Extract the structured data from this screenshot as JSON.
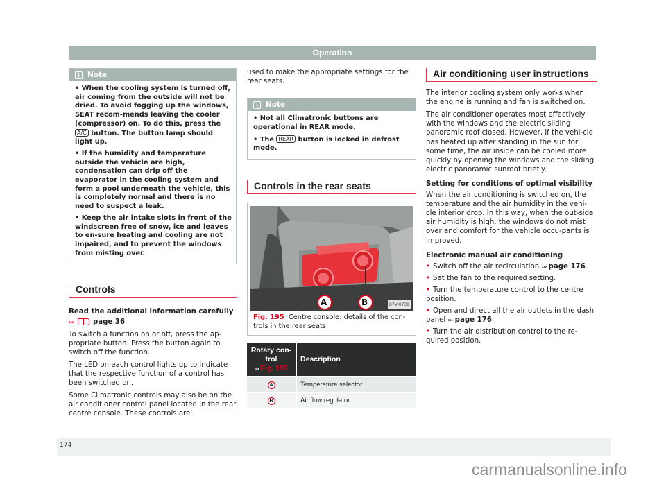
{
  "header": {
    "title": "Operation"
  },
  "col1": {
    "note": {
      "label": "Note",
      "items": [
        {
          "pre": "When the cooling system is turned off, air coming from the outside will not be dried. To avoid fogging up the windows, SEAT recom-mends leaving the cooler (compressor) on. To do this, press the ",
          "key": "A/C",
          "post": " button. The button lamp should light up."
        },
        {
          "text": "If the humidity and temperature outside the vehicle are high, condensation can drip off the evaporator in the cooling system and form a pool underneath the vehicle, this is completely normal and there is no need to suspect a leak."
        },
        {
          "text": "Keep the air intake slots in front of the windscreen free of snow, ice and leaves to en-sure heating and cooling are not impaired, and to prevent the windows from misting over."
        }
      ]
    },
    "controls": {
      "title": "Controls",
      "read_more": "Read the additional information carefully",
      "arrow": "›››",
      "page_ref": "page 36",
      "paragraphs": [
        "To switch a function on or off, press the ap-propriate button. Press the button again to switch off the function.",
        "The LED on each control lights up to indicate that the respective function of a control has been switched on.",
        "Some Climatronic controls may also be on the air conditioner control panel located in the rear centre console. These controls are"
      ]
    }
  },
  "col2": {
    "continuation": "used to make the appropriate settings for the rear seats.",
    "note": {
      "label": "Note",
      "item1": "Not all Climatronic buttons are operational in REAR mode.",
      "item2_pre": "The ",
      "item2_key": "REAR",
      "item2_post": " button is locked in defrost mode."
    },
    "section_title": "Controls in the rear seats",
    "figure": {
      "label_a": "A",
      "label_b": "B",
      "code": "B7V-0738",
      "caption_num": "Fig. 195",
      "caption_text": "Centre console: details of the con-trols in the rear seats"
    },
    "table": {
      "header_col1_line1": "Rotary con-trol",
      "header_col1_arrow": "›››",
      "header_col1_ref": "Fig. 195",
      "header_col2": "Description",
      "rows": [
        {
          "key": "A",
          "description": "Temperature selector"
        },
        {
          "key": "B",
          "description": "Air flow regulator"
        }
      ]
    }
  },
  "col3": {
    "section_title": "Air conditioning user instructions",
    "paragraphs": [
      "The interior cooling system only works when the engine is running and fan is switched on.",
      "The air conditioner operates most effectively with the windows and the electric sliding panoramic roof closed. However, if the vehi-cle has heated up after standing in the sun for some time, the air inside can be cooled more quickly by opening the windows and the sliding electric panoramic sunroof briefly."
    ],
    "visibility": {
      "heading": "Setting for conditions of optimal visibility",
      "text": "When the air conditioning is switched on, the temperature and the air humidity in the vehi-cle interior drop. In this way, when the out-side air humidity is high, the windows do not mist over and comfort for the vehicle occu-pants is improved."
    },
    "electronic": {
      "heading": "Electronic manual air conditioning",
      "arrow": "›››",
      "steps": [
        {
          "text": "Switch off the air recirculation ",
          "ref": "page 176",
          "end": "."
        },
        {
          "text": "Set the fan to the required setting."
        },
        {
          "text": "Turn the temperature control to the centre position."
        },
        {
          "text": "Open and direct all the air outlets in the dash panel ",
          "ref": "page 176",
          "end": "."
        },
        {
          "text": "Turn the air distribution control to the re-quired position."
        }
      ]
    }
  },
  "footer": {
    "page_number": "174",
    "watermark": "carmanualsonline.info"
  }
}
